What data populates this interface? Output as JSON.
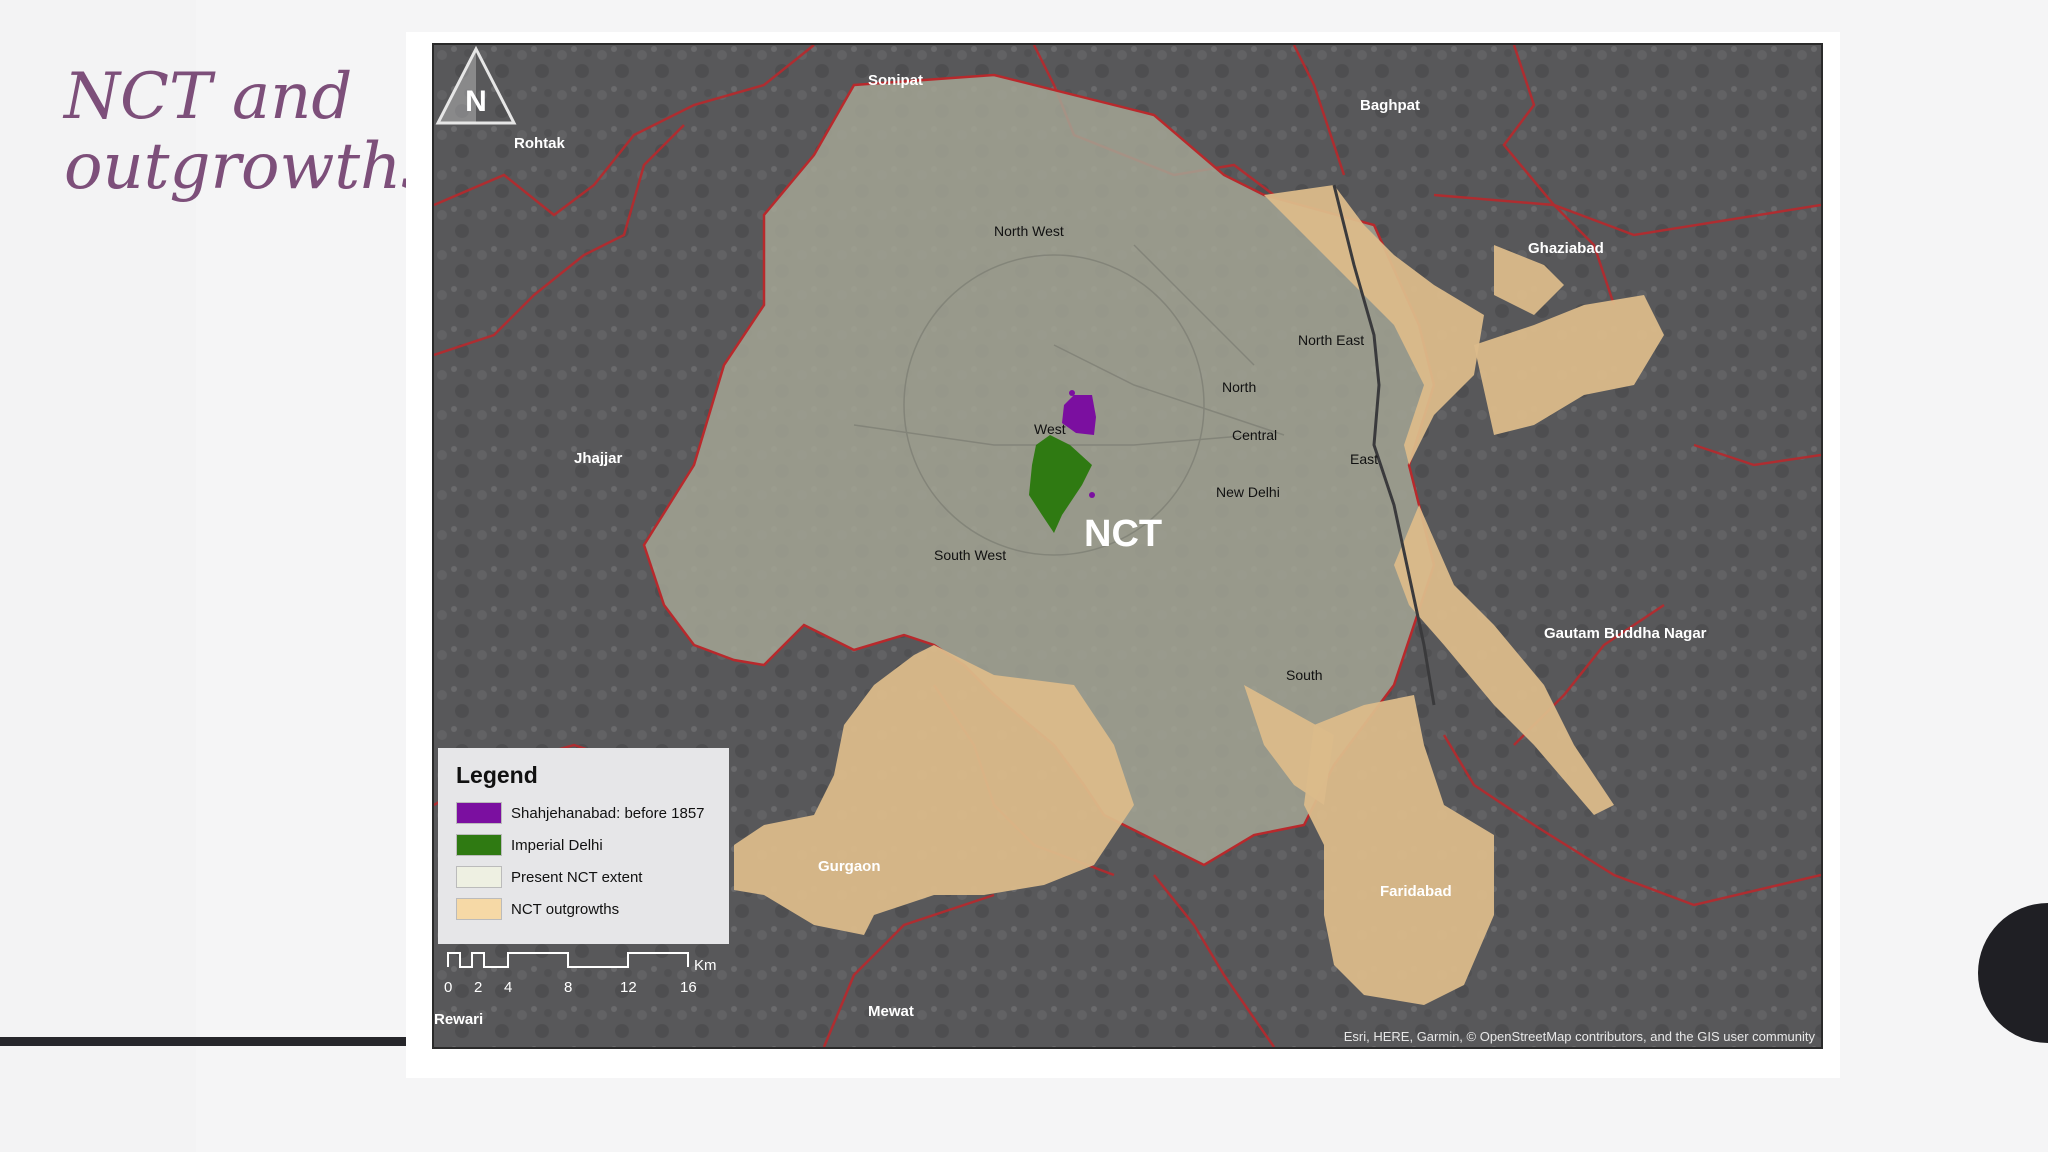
{
  "slide": {
    "title_line1": "NCT and",
    "title_line2": "outgrowths"
  },
  "map": {
    "nct_label": "NCT",
    "outer_places": [
      {
        "key": "sonipat",
        "label": "Sonipat"
      },
      {
        "key": "baghpat",
        "label": "Baghpat"
      },
      {
        "key": "rohtak",
        "label": "Rohtak"
      },
      {
        "key": "ghaziabad",
        "label": "Ghaziabad"
      },
      {
        "key": "jhajjar",
        "label": "Jhajjar"
      },
      {
        "key": "gautam",
        "label": "Gautam Buddha Nagar"
      },
      {
        "key": "gurgaon",
        "label": "Gurgaon"
      },
      {
        "key": "faridabad",
        "label": "Faridabad"
      },
      {
        "key": "mewat",
        "label": "Mewat"
      },
      {
        "key": "rewari",
        "label": "Rewari"
      }
    ],
    "districts": [
      {
        "key": "north_west",
        "label": "North West"
      },
      {
        "key": "north_east",
        "label": "North East"
      },
      {
        "key": "north",
        "label": "North"
      },
      {
        "key": "west",
        "label": "West"
      },
      {
        "key": "central",
        "label": "Central"
      },
      {
        "key": "east",
        "label": "East"
      },
      {
        "key": "new_delhi",
        "label": "New Delhi"
      },
      {
        "key": "south_west",
        "label": "South West"
      },
      {
        "key": "south",
        "label": "South"
      }
    ],
    "legend": {
      "title": "Legend",
      "items": [
        {
          "label": "Shahjehanabad: before 1857",
          "color": "#7b0fa0"
        },
        {
          "label": "Imperial Delhi",
          "color": "#2f7a12"
        },
        {
          "label": "Present NCT extent",
          "color": "#eef0e2"
        },
        {
          "label": "NCT outgrowths",
          "color": "#f6d9a6"
        }
      ]
    },
    "scale": {
      "unit": "Km",
      "ticks": [
        "0",
        "2",
        "4",
        "8",
        "12",
        "16"
      ]
    },
    "north_arrow_letter": "N",
    "credits": "Esri, HERE, Garmin, © OpenStreetMap contributors, and the GIS user community",
    "colors": {
      "basemap": "#5a5a5c",
      "nct_fill": "#9a9b8c",
      "outgrowth_fill": "#d8b98a",
      "boundary": "#b8292c"
    }
  }
}
